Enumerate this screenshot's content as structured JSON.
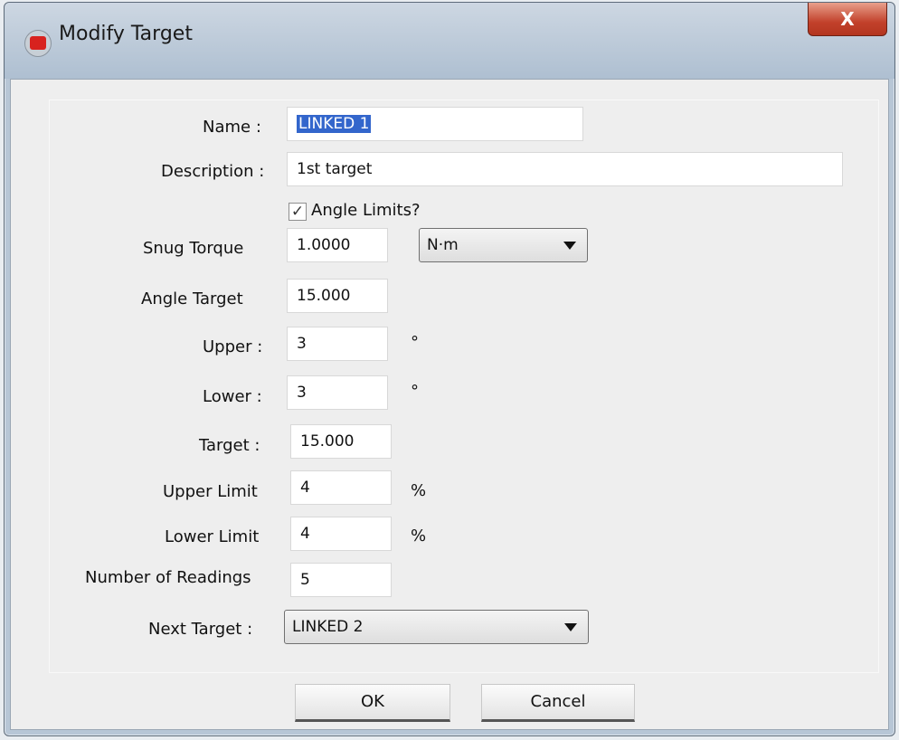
{
  "window": {
    "title": "Modify Target",
    "close_label": "X"
  },
  "form": {
    "name": {
      "label": "Name :",
      "value": "LINKED 1"
    },
    "description": {
      "label": "Description :",
      "value": "1st target"
    },
    "angle_limits": {
      "label": "Angle Limits?",
      "checked": true,
      "check_glyph": "✓"
    },
    "snug_torque": {
      "label": "Snug Torque",
      "value": "1.0000",
      "unit": "N·m"
    },
    "angle_target": {
      "label": "Angle Target",
      "value": "15.000"
    },
    "upper": {
      "label": "Upper :",
      "value": "3",
      "unit": "°"
    },
    "lower": {
      "label": "Lower :",
      "value": "3",
      "unit": "°"
    },
    "target": {
      "label": "Target :",
      "value": "15.000"
    },
    "upper_limit": {
      "label": "Upper Limit",
      "value": "4",
      "unit": "%"
    },
    "lower_limit": {
      "label": "Lower Limit",
      "value": "4",
      "unit": "%"
    },
    "number_of_readings": {
      "label": "Number of Readings",
      "value": "5"
    },
    "next_target": {
      "label": "Next Target :",
      "value": "LINKED 2"
    }
  },
  "buttons": {
    "ok": "OK",
    "cancel": "Cancel"
  },
  "icons": {
    "app": "app-icon",
    "close": "close-icon",
    "dropdown": "chevron-down-icon",
    "checkbox": "checkmark-icon"
  },
  "colors": {
    "selection": "#3366cc",
    "close_button": "#c2412b"
  }
}
